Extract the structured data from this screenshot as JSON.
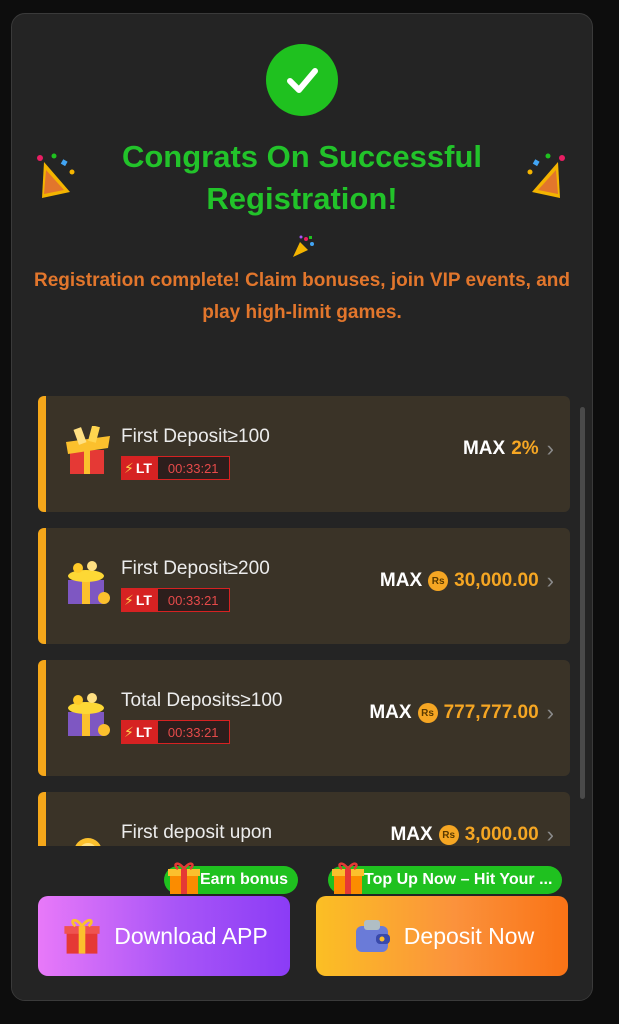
{
  "header": {
    "title": "Congrats On Successful Registration!",
    "subtitle": "Registration complete! Claim bonuses, join VIP events, and play high-limit games.",
    "icons": [
      "check-icon",
      "party-popper-icon",
      "confetti-icon"
    ]
  },
  "bonuses": [
    {
      "label": "First Deposit≥100",
      "lt": "LT",
      "timer": "00:33:21",
      "max": "MAX",
      "value": "2%",
      "currency_icon": false
    },
    {
      "label": "First Deposit≥200",
      "lt": "LT",
      "timer": "00:33:21",
      "max": "MAX",
      "value": "30,000.00",
      "currency_icon": true
    },
    {
      "label": "Total Deposits≥100",
      "lt": "LT",
      "timer": "00:33:21",
      "max": "MAX",
      "value": "777,777.00",
      "currency_icon": true
    },
    {
      "label": "First deposit upon",
      "max": "MAX",
      "value": "3,000.00",
      "currency_icon": true
    }
  ],
  "currency_symbol": "Rs",
  "actions": {
    "download": {
      "label": "Download APP",
      "badge": "Earn bonus"
    },
    "deposit": {
      "label": "Deposit Now",
      "badge": "Top Up Now – Hit Your ..."
    }
  },
  "colors": {
    "accent_green": "#22c32a",
    "accent_orange": "#e2762c",
    "gold": "#f5a623",
    "card_bg": "#3a3327",
    "timer_red": "#d62222"
  }
}
